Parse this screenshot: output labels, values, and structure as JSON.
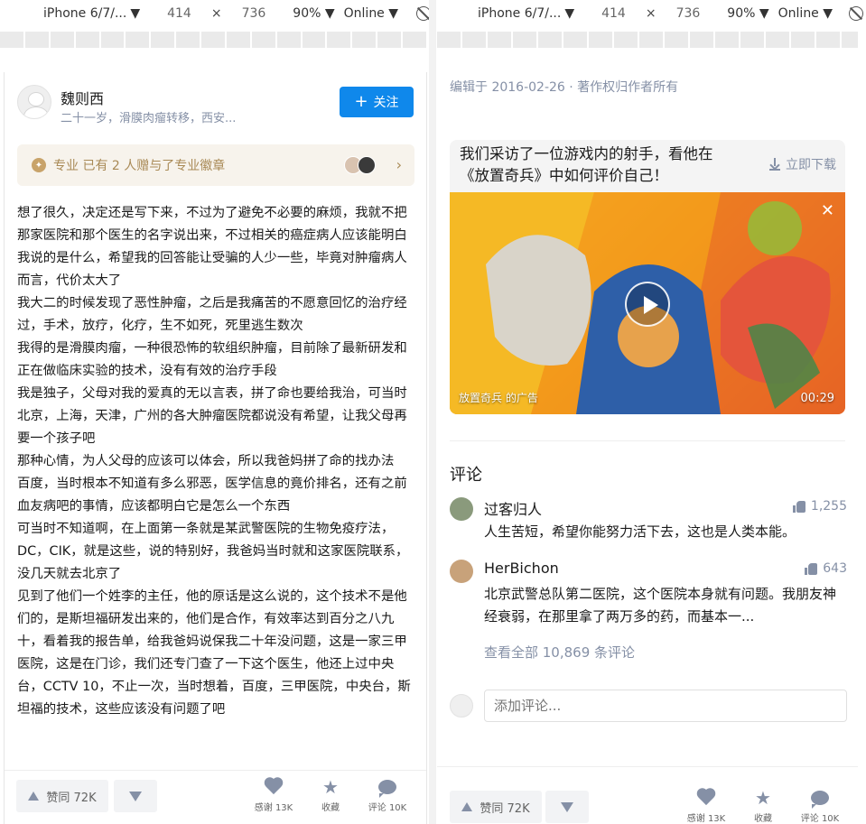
{
  "devtools": [
    {
      "device": "iPhone 6/7/...",
      "width": "414",
      "height": "736",
      "zoom": "90%",
      "network": "Online"
    },
    {
      "device": "iPhone 6/7/...",
      "width": "414",
      "height": "736",
      "zoom": "90%",
      "network": "Online"
    }
  ],
  "left": {
    "author": {
      "name": "魏则西",
      "bio": "二十一岁，滑膜肉瘤转移，西安...",
      "follow_label": "关注"
    },
    "badge": {
      "text": "专业 已有 2 人赠与了专业徽章",
      "arrow": "›"
    },
    "answer_paragraphs": [
      "想了很久，决定还是写下来，不过为了避免不必要的麻烦，我就不把那家医院和那个医生的名字说出来，不过相关的癌症病人应该能明白我说的是什么，希望我的回答能让受骗的人少一些，毕竟对肿瘤病人而言，代价太大了",
      "我大二的时候发现了恶性肿瘤，之后是我痛苦的不愿意回忆的治疗经过，手术，放疗，化疗，生不如死，死里逃生数次",
      "我得的是滑膜肉瘤，一种很恐怖的软组织肿瘤，目前除了最新研发和正在做临床实验的技术，没有有效的治疗手段",
      "我是独子，父母对我的爱真的无以言表，拼了命也要给我治，可当时北京，上海，天津，广州的各大肿瘤医院都说没有希望，让我父母再要一个孩子吧",
      "那种心情，为人父母的应该可以体会，所以我爸妈拼了命的找办法",
      "百度，当时根本不知道有多么邪恶，医学信息的竟价排名，还有之前血友病吧的事情，应该都明白它是怎么一个东西",
      "可当时不知道啊，在上面第一条就是某武警医院的生物免疫疗法，DC，CIK，就是这些，说的特别好，我爸妈当时就和这家医院联系，没几天就去北京了",
      "见到了他们一个姓李的主任，他的原话是这么说的，这个技术不是他们的，是斯坦福研发出来的，他们是合作，有效率达到百分之八九十，看着我的报告单，给我爸妈说保我二十年没问题，这是一家三甲医院，这是在门诊，我们还专门查了一下这个医生，他还上过中央台，CCTV 10，不止一次，当时想着，百度，三甲医院，中央台，斯坦福的技术，这些应该没有问题了吧"
    ],
    "actions": {
      "vote_up": "赞同 72K",
      "thanks": "感谢 13K",
      "collect": "收藏",
      "comment": "评论 10K"
    }
  },
  "right": {
    "edit_info": "编辑于 2016-02-26 · 著作权归作者所有",
    "ad": {
      "title": "我们采访了一位游戏内的射手，看他在《放置奇兵》中如何评价自己！",
      "download": "立即下载",
      "video_label": "放置奇兵 的广告",
      "duration": "00:29",
      "close": "✕"
    },
    "comments_title": "评论",
    "comments": [
      {
        "name": "过客归人",
        "likes": "1,255",
        "text": "人生苦短，希望你能努力活下去，这也是人类本能。",
        "avatar_color": "#8a9a7c"
      },
      {
        "name": "HerBichon",
        "likes": "643",
        "text": "北京武警总队第二医院，这个医院本身就有问题。我朋友神经衰弱，在那里拿了两万多的药，而基本一...",
        "avatar_color": "#c8a27a"
      }
    ],
    "view_all": "查看全部 10,869 条评论",
    "add_comment_placeholder": "添加评论...",
    "actions": {
      "vote_up": "赞同 72K",
      "thanks": "感谢 13K",
      "collect": "收藏",
      "comment": "评论 10K"
    }
  },
  "colors": {
    "accent": "#0f88eb",
    "muted": "#8590a6",
    "badge_bg": "#f7f3ec",
    "badge_text": "#a98a56"
  },
  "icons": [
    "chevron-down-icon",
    "rotate-icon",
    "plus-icon",
    "badge-icon",
    "download-icon",
    "play-icon",
    "close-icon",
    "thumb-up-icon",
    "heart-icon",
    "star-icon",
    "comment-bubble-icon"
  ]
}
